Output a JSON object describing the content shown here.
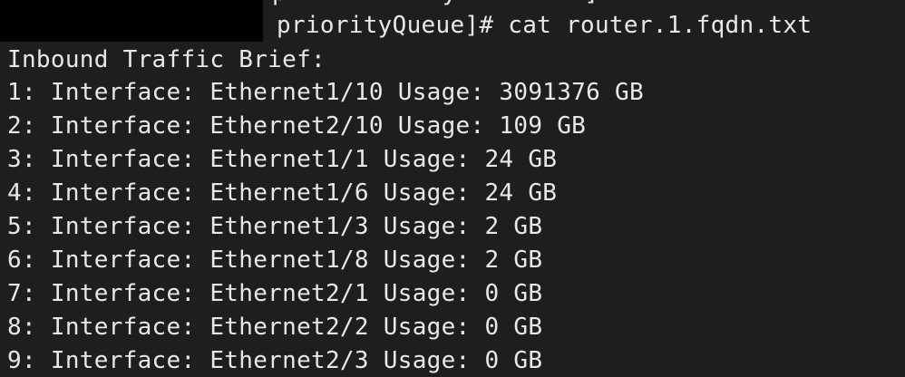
{
  "terminal": {
    "clipped_top_text": "p           y         ]",
    "prompt": "priorityQueue]# cat router.1.fqdn.txt",
    "output_header": "Inbound Traffic Brief:",
    "rows": [
      "1: Interface: Ethernet1/10 Usage: 3091376 GB",
      "2: Interface: Ethernet2/10 Usage: 109 GB",
      "3: Interface: Ethernet1/1 Usage: 24 GB",
      "4: Interface: Ethernet1/6 Usage: 24 GB",
      "5: Interface: Ethernet1/3 Usage: 2 GB",
      "6: Interface: Ethernet1/8 Usage: 2 GB",
      "7: Interface: Ethernet2/1 Usage: 0 GB",
      "8: Interface: Ethernet2/2 Usage: 0 GB",
      "9: Interface: Ethernet2/3 Usage: 0 GB"
    ],
    "colors": {
      "background": "#1e1e1e",
      "text": "#e8e8e8",
      "redaction": "#000000"
    }
  }
}
